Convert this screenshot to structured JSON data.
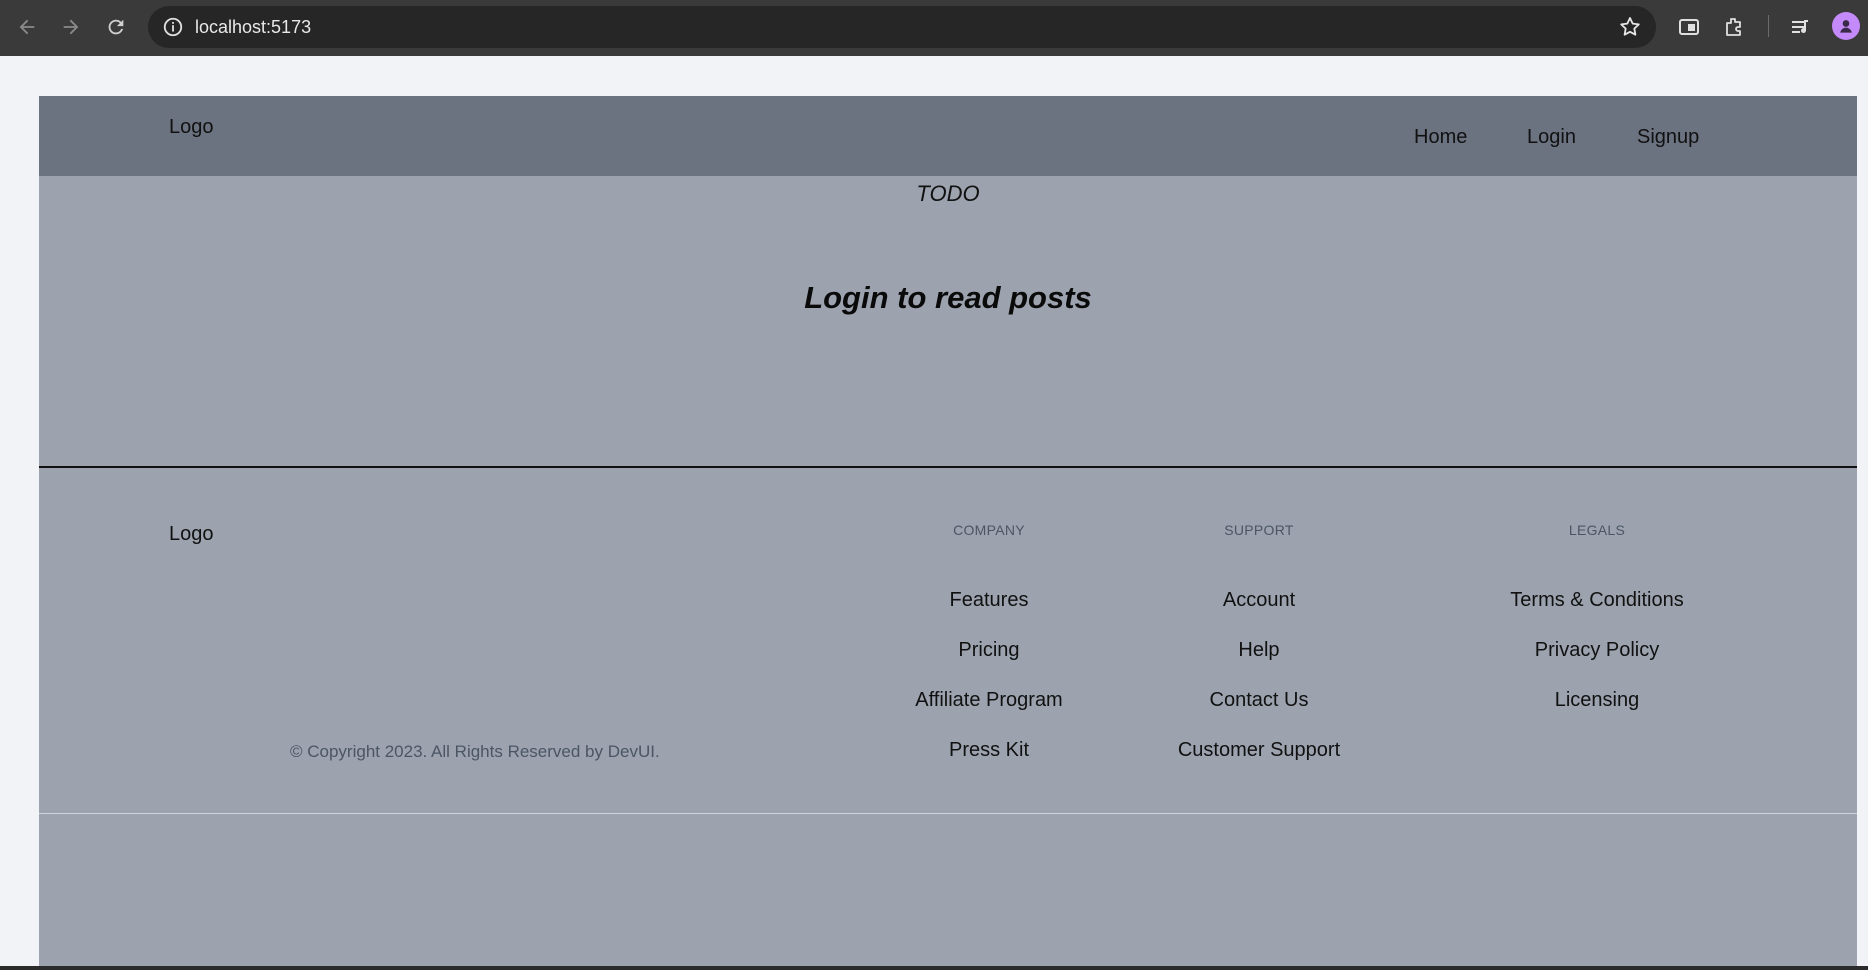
{
  "browser": {
    "url": "localhost:5173",
    "icons": [
      "back-icon",
      "forward-icon",
      "reload-icon",
      "site-info-icon",
      "bookmark-star-icon",
      "side-panel-icon",
      "extensions-icon",
      "media-queue-icon",
      "profile-avatar-icon"
    ]
  },
  "header": {
    "logo": "Logo",
    "nav": [
      {
        "label": "Home"
      },
      {
        "label": "Login"
      },
      {
        "label": "Signup"
      }
    ]
  },
  "hero": {
    "todo": "TODO",
    "message": "Login to read posts"
  },
  "footer": {
    "logo": "Logo",
    "copyright": "© Copyright 2023. All Rights Reserved by DevUI.",
    "columns": [
      {
        "title": "COMPANY",
        "links": [
          "Features",
          "Pricing",
          "Affiliate Program",
          "Press Kit"
        ]
      },
      {
        "title": "SUPPORT",
        "links": [
          "Account",
          "Help",
          "Contact Us",
          "Customer Support"
        ]
      },
      {
        "title": "LEGALS",
        "links": [
          "Terms & Conditions",
          "Privacy Policy",
          "Licensing"
        ]
      }
    ]
  },
  "colors": {
    "header_bg": "#6b7280",
    "page_bg": "#9ca3af",
    "chrome_bg": "#3a3a3a",
    "avatar": "#c58af9"
  }
}
